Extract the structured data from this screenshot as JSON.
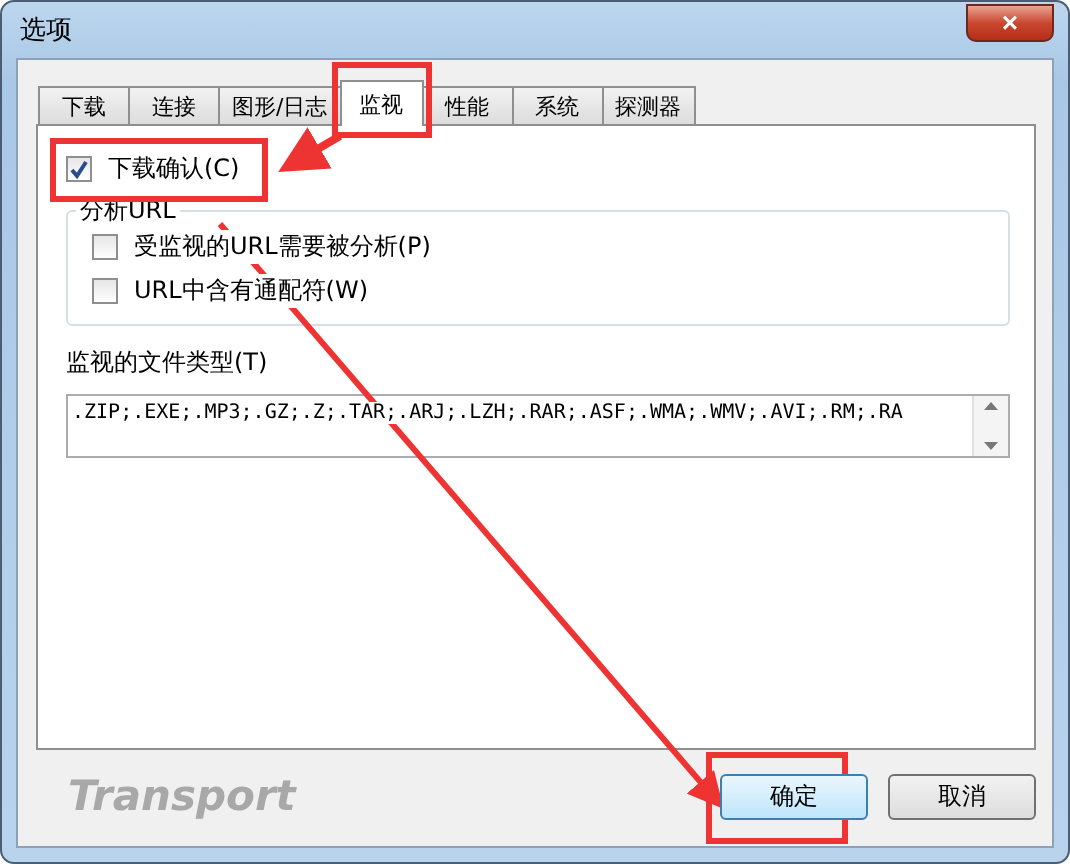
{
  "window": {
    "title": "选项",
    "close": "×"
  },
  "tabs": [
    {
      "label": "下载",
      "selected": false
    },
    {
      "label": "连接",
      "selected": false
    },
    {
      "label": "图形/日志",
      "selected": false
    },
    {
      "label": "监视",
      "selected": true
    },
    {
      "label": "性能",
      "selected": false
    },
    {
      "label": "系统",
      "selected": false
    },
    {
      "label": "探测器",
      "selected": false
    }
  ],
  "confirm_download": {
    "label": "下载确认(C)",
    "checked": true
  },
  "url_group": {
    "title": "分析URL",
    "options": [
      {
        "label": "受监视的URL需要被分析(P)",
        "checked": false
      },
      {
        "label": "URL中含有通配符(W)",
        "checked": false
      }
    ]
  },
  "file_types": {
    "label": "监视的文件类型(T)",
    "value": ".ZIP;.EXE;.MP3;.GZ;.Z;.TAR;.ARJ;.LZH;.RAR;.ASF;.WMA;.WMV;.AVI;.RM;.RA"
  },
  "footer": {
    "brand": "Transport",
    "buttons": [
      "确定",
      "取消"
    ]
  }
}
